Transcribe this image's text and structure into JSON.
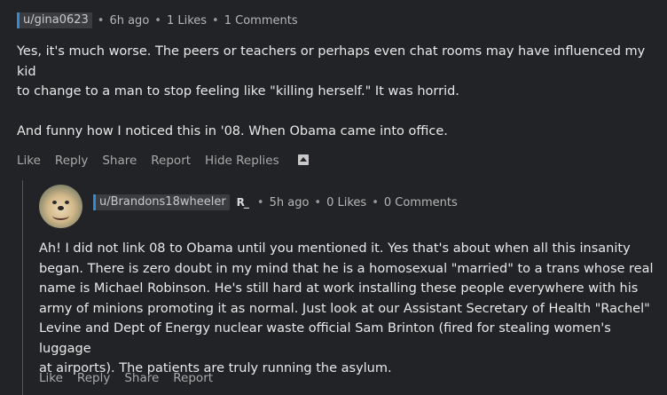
{
  "parent": {
    "username": "u/gina0623",
    "time": "6h ago",
    "likes": "1 Likes",
    "comments": "1 Comments",
    "body": [
      "Yes, it's much worse. The peers or teachers or perhaps even chat rooms may have influenced my kid",
      "to change to a man to stop feeling like \"killing herself.\" It was horrid.",
      "",
      "And funny how I noticed this in '08. When Obama came into office."
    ],
    "actions": {
      "like": "Like",
      "reply": "Reply",
      "share": "Share",
      "report": "Report",
      "hide": "Hide Replies"
    }
  },
  "reply": {
    "username": "u/Brandons18wheeler",
    "rank": "R_",
    "time": "5h ago",
    "likes": "0 Likes",
    "comments": "0 Comments",
    "body": [
      "Ah! I did not link 08 to Obama until you mentioned it. Yes that's about when all this insanity",
      "began. There is zero doubt in my mind that he is a homosexual \"married\" to a trans whose real",
      "name is Michael Robinson. He's still hard at work installing these people everywhere with his",
      "army of minions promoting it as normal. Just look at our Assistant Secretary of Health \"Rachel\"",
      "Levine and Dept of Energy nuclear waste official Sam Brinton (fired for stealing women's luggage",
      "at airports). The patients are truly running the asylum."
    ],
    "actions": {
      "like": "Like",
      "reply": "Reply",
      "share": "Share",
      "report": "Report"
    }
  },
  "colors": {
    "background": "#222326",
    "accent": "#2f8bd8"
  },
  "icons": {
    "hide": "caret-up-box-icon",
    "avatar": "dog-avatar"
  }
}
